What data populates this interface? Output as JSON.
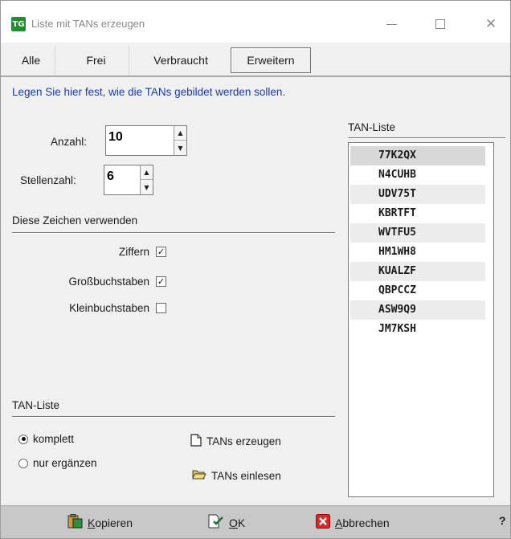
{
  "window": {
    "title": "Liste mit TANs erzeugen",
    "icon": "tan-app-icon",
    "icon_text": "TG",
    "controls": {
      "minimize": "—",
      "maximize": "☐",
      "close": "✕"
    }
  },
  "tabs": [
    {
      "label": "Alle"
    },
    {
      "label": "Frei"
    },
    {
      "label": "Verbraucht"
    },
    {
      "label": "Erweitern",
      "active": true
    }
  ],
  "info_text": "Legen Sie hier fest, wie die TANs gebildet werden sollen.",
  "settings": {
    "anzahl": {
      "label": "Anzahl:",
      "value": "10"
    },
    "stellenzahl": {
      "label": "Stellenzahl:",
      "value": "6"
    }
  },
  "characters": {
    "heading": "Diese Zeichen verwenden",
    "options": [
      {
        "label": "Ziffern",
        "checked": true,
        "mark": "✓"
      },
      {
        "label": "Großbuchstaben",
        "checked": true,
        "mark": "✓"
      },
      {
        "label": "Kleinbuchstaben",
        "checked": false,
        "mark": ""
      }
    ]
  },
  "tan_mode": {
    "heading": "TAN-Liste",
    "options": [
      {
        "label": "komplett",
        "selected": true
      },
      {
        "label": "nur ergänzen",
        "selected": false
      }
    ]
  },
  "actions": {
    "generate": "TANs erzeugen",
    "import": "TANs einlesen"
  },
  "tan_list": {
    "heading": "TAN-Liste",
    "items": [
      "77K2QX",
      "N4CUHB",
      "UDV75T",
      "KBRTFT",
      "WVTFU5",
      "HM1WH8",
      "KUALZF",
      "QBPCCZ",
      "ASW9Q9",
      "JM7KSH"
    ],
    "selected_index": 0
  },
  "buttons": {
    "copy": "Kopieren",
    "ok": "OK",
    "cancel": "Abbrechen",
    "help": "?"
  },
  "colors": {
    "info_text": "#1a3aa8",
    "app_icon": "#1d8f2f",
    "cancel_icon": "#d62828"
  }
}
